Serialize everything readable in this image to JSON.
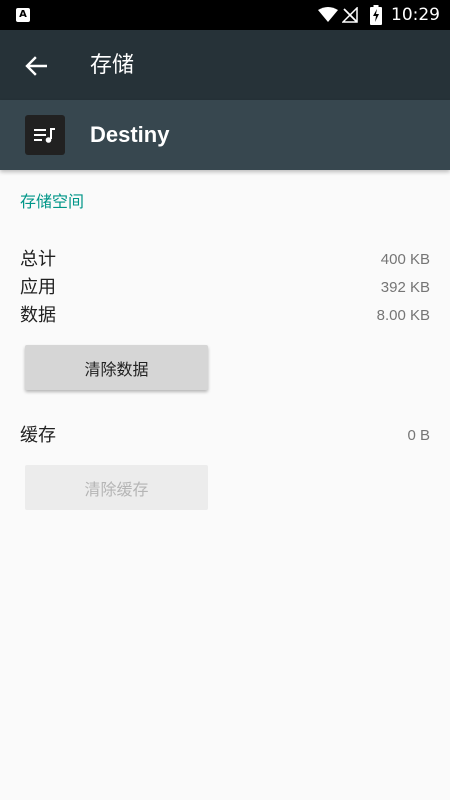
{
  "status_bar": {
    "left_icon_letter": "A",
    "time": "10:29",
    "icons": [
      "wifi-icon",
      "no-signal-icon",
      "battery-charging-icon"
    ]
  },
  "app_bar": {
    "back_icon": "arrow-left-icon",
    "title": "存储"
  },
  "app_header": {
    "icon": "playlist-music-icon",
    "name": "Destiny"
  },
  "storage": {
    "section_title": "存储空间",
    "rows": [
      {
        "label": "总计",
        "value": "400 KB"
      },
      {
        "label": "应用",
        "value": "392 KB"
      },
      {
        "label": "数据",
        "value": "8.00 KB"
      }
    ],
    "clear_data_label": "清除数据"
  },
  "cache": {
    "label": "缓存",
    "value": "0 B",
    "clear_cache_label": "清除缓存",
    "clear_cache_enabled": false
  },
  "colors": {
    "status_bar": "#000000",
    "app_bar": "#263238",
    "app_header": "#37474f",
    "accent": "#009688",
    "background": "#fafafa"
  }
}
